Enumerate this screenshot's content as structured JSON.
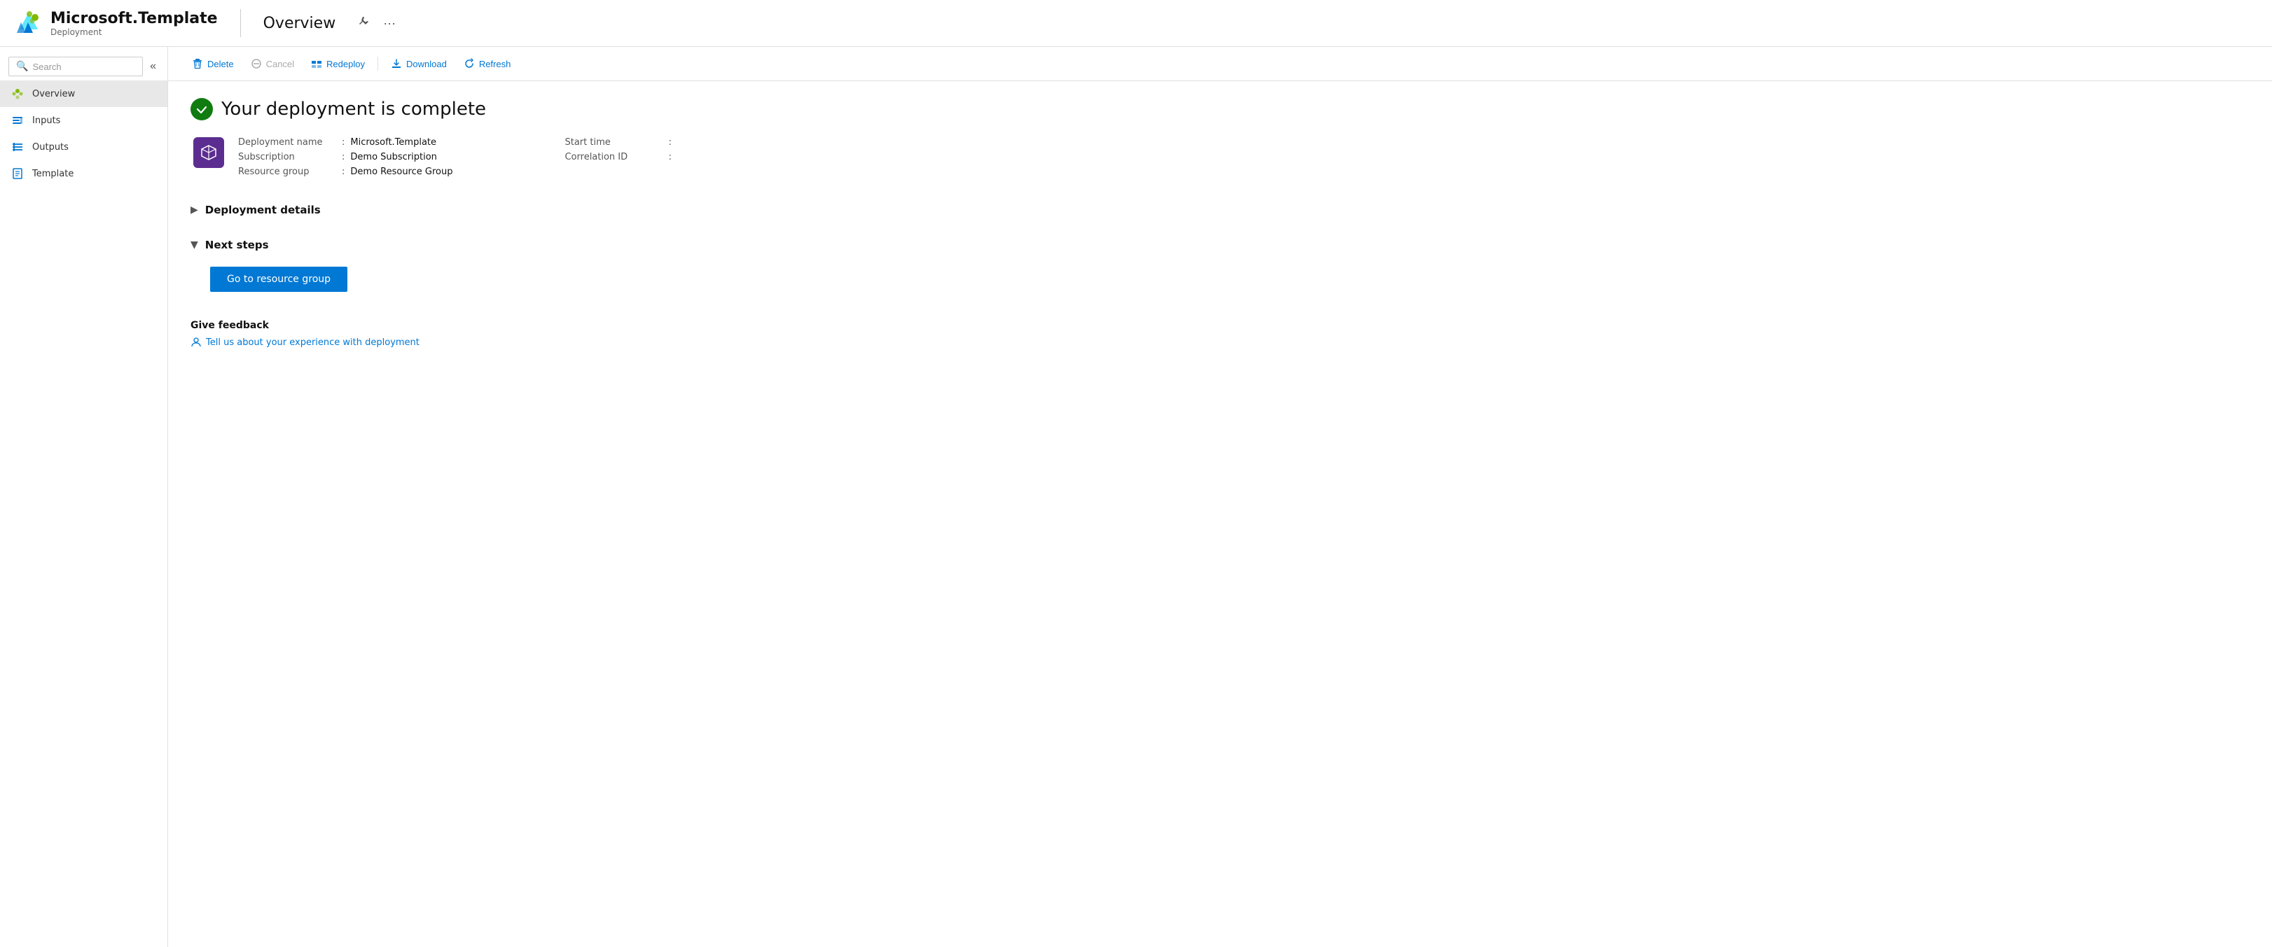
{
  "header": {
    "app_name": "Microsoft.Template",
    "app_subtitle": "Deployment",
    "page_title": "Overview",
    "pin_icon": "📌",
    "more_icon": "···"
  },
  "sidebar": {
    "search_placeholder": "Search",
    "collapse_icon": "«",
    "items": [
      {
        "id": "overview",
        "label": "Overview",
        "icon": "overview",
        "active": true
      },
      {
        "id": "inputs",
        "label": "Inputs",
        "icon": "inputs",
        "active": false
      },
      {
        "id": "outputs",
        "label": "Outputs",
        "icon": "outputs",
        "active": false
      },
      {
        "id": "template",
        "label": "Template",
        "icon": "template",
        "active": false
      }
    ]
  },
  "toolbar": {
    "delete_label": "Delete",
    "cancel_label": "Cancel",
    "redeploy_label": "Redeploy",
    "download_label": "Download",
    "refresh_label": "Refresh"
  },
  "content": {
    "deployment_complete_text": "Your deployment is complete",
    "deployment_name_label": "Deployment name",
    "deployment_name_value": "Microsoft.Template",
    "subscription_label": "Subscription",
    "subscription_value": "Demo Subscription",
    "resource_group_label": "Resource group",
    "resource_group_value": "Demo Resource Group",
    "start_time_label": "Start time",
    "start_time_value": "",
    "correlation_id_label": "Correlation ID",
    "correlation_id_value": "",
    "deployment_details_label": "Deployment details",
    "next_steps_label": "Next steps",
    "go_to_resource_group_label": "Go to resource group",
    "feedback_title": "Give feedback",
    "feedback_link_text": "Tell us about your experience with deployment"
  }
}
